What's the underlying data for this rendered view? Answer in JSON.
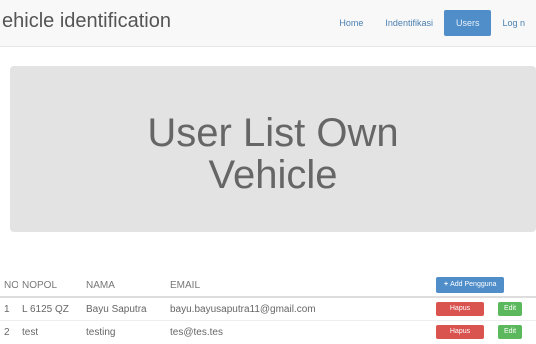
{
  "navbar": {
    "brand": "ehicle identification",
    "links": [
      "Home",
      "Indentifikasi",
      "Users",
      "Log n"
    ],
    "active_index": 2
  },
  "jumbotron": {
    "title_line1": "User List Own",
    "title_line2": "Vehicle"
  },
  "table": {
    "headers": [
      "NO",
      "NOPOL",
      "NAMA",
      "EMAIL"
    ],
    "add_button": {
      "icon": "+",
      "label": "Add Pengguna"
    },
    "rows": [
      {
        "no": "1",
        "nopol": "L 6125 QZ",
        "nama": "Bayu Saputra",
        "email": "bayu.bayusaputra11@gmail.com",
        "delete_label": "Hapus",
        "edit_label": "Edit"
      },
      {
        "no": "2",
        "nopol": "test",
        "nama": "testing",
        "email": "tes@tes.tes",
        "delete_label": "Hapus",
        "edit_label": "Edit"
      }
    ]
  },
  "colors": {
    "primary": "#4f8ec9",
    "danger": "#d9534f",
    "success": "#5cb85c",
    "jumbotron_bg": "#e3e3e3"
  }
}
